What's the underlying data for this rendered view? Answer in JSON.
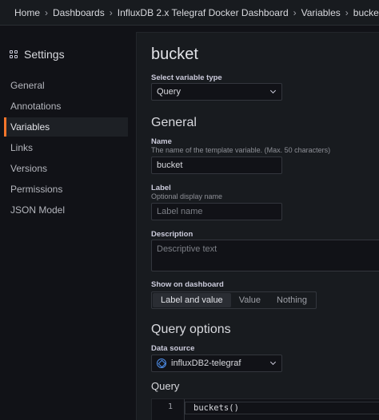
{
  "topbar": {
    "breadcrumbs": [
      "Home",
      "Dashboards",
      "InfluxDB 2.x Telegraf Docker Dashboard",
      "Variables",
      "bucket"
    ],
    "separator": "›"
  },
  "sidebar": {
    "title": "Settings",
    "title_icon": "grid-icon",
    "items": [
      {
        "label": "General"
      },
      {
        "label": "Annotations"
      },
      {
        "label": "Variables",
        "active": true
      },
      {
        "label": "Links"
      },
      {
        "label": "Versions"
      },
      {
        "label": "Permissions"
      },
      {
        "label": "JSON Model"
      }
    ]
  },
  "main": {
    "title": "bucket",
    "variable_type": {
      "label": "Select variable type",
      "value": "Query"
    },
    "general": {
      "heading": "General",
      "name": {
        "label": "Name",
        "description": "The name of the template variable. (Max. 50 characters)",
        "value": "bucket"
      },
      "label": {
        "label": "Label",
        "description": "Optional display name",
        "placeholder": "Label name"
      },
      "description": {
        "label": "Description",
        "placeholder": "Descriptive text"
      },
      "show_on_dashboard": {
        "label": "Show on dashboard",
        "options": [
          "Label and value",
          "Value",
          "Nothing"
        ],
        "selected": "Label and value"
      }
    },
    "query_options": {
      "heading": "Query options",
      "data_source": {
        "label": "Data source",
        "value": "influxDB2-telegraf",
        "icon": "influxdb-icon"
      },
      "query": {
        "label": "Query",
        "line_number": "1",
        "code": "buckets()"
      }
    }
  },
  "colors": {
    "accent": "#f5752b",
    "background": "#111217",
    "panel": "#181b1f"
  }
}
